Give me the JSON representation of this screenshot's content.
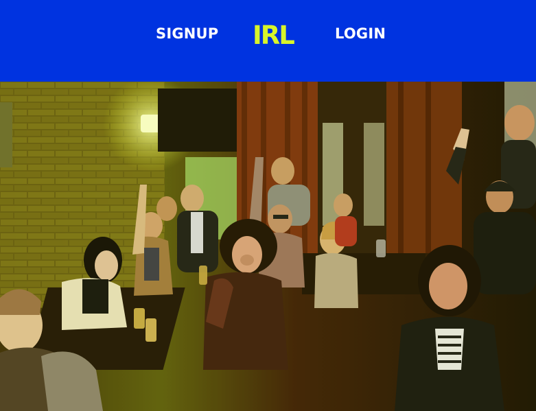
{
  "header": {
    "background_color": "#0033e0",
    "signup_label": "SIGNUP",
    "logo_text": "IRL",
    "logo_color": "#d8f52a",
    "login_label": "LOGIN"
  },
  "hero": {
    "image": "photo-of-crowd-in-bar-raising-hands"
  }
}
